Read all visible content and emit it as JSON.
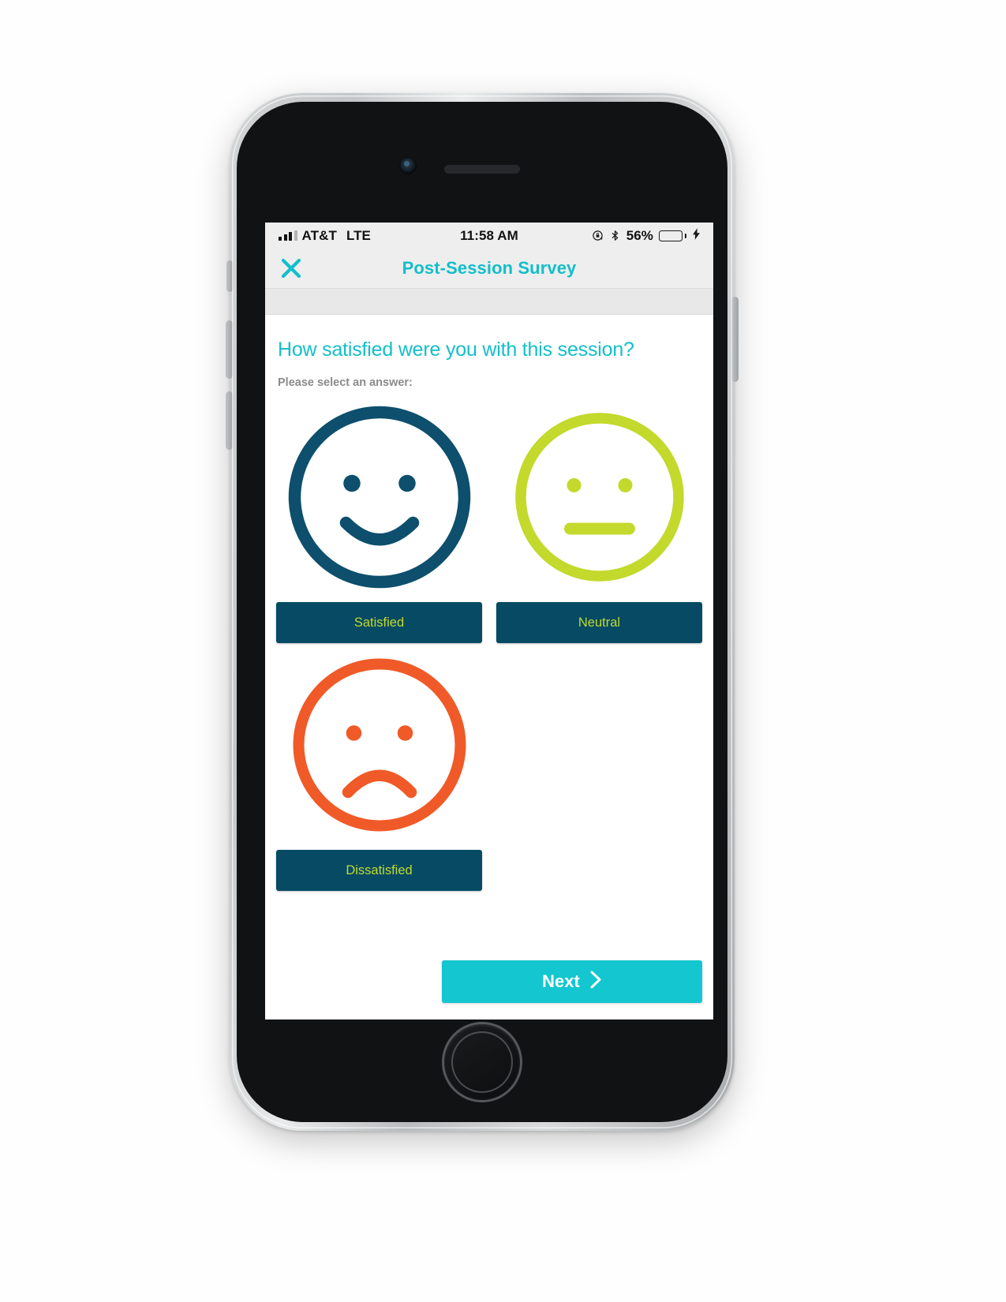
{
  "device": {
    "name": "iphone-mockup"
  },
  "status_bar": {
    "signal_icon": "signal-bars-icon",
    "carrier": "AT&T",
    "network": "LTE",
    "time": "11:58 AM",
    "rotation_lock_icon": "rotation-lock-icon",
    "bluetooth_icon": "bluetooth-icon",
    "battery_percent": "56%",
    "battery_level": 56,
    "charging_icon": "lightning-bolt-icon",
    "battery_color": "#f6c800"
  },
  "nav_bar": {
    "close_icon": "close-x-icon",
    "title": "Post-Session Survey",
    "title_color": "#12bfca"
  },
  "survey": {
    "question": "How satisfied were you with this session?",
    "question_color": "#12bfca",
    "instruction": "Please select an answer:",
    "options": [
      {
        "label": "Satisfied",
        "icon": "happy-face-icon",
        "face": "happy",
        "color": "#0d4f6c"
      },
      {
        "label": "Neutral",
        "icon": "neutral-face-icon",
        "face": "neutral",
        "color": "#c3d92c"
      },
      {
        "label": "Dissatisfied",
        "icon": "sad-face-icon",
        "face": "sad",
        "color": "#f05a28"
      }
    ],
    "button_bg": "#064a63",
    "button_text_color": "#c3d92c"
  },
  "footer": {
    "next_label": "Next",
    "next_icon": "chevron-right-icon",
    "next_bg": "#13c6cf"
  }
}
